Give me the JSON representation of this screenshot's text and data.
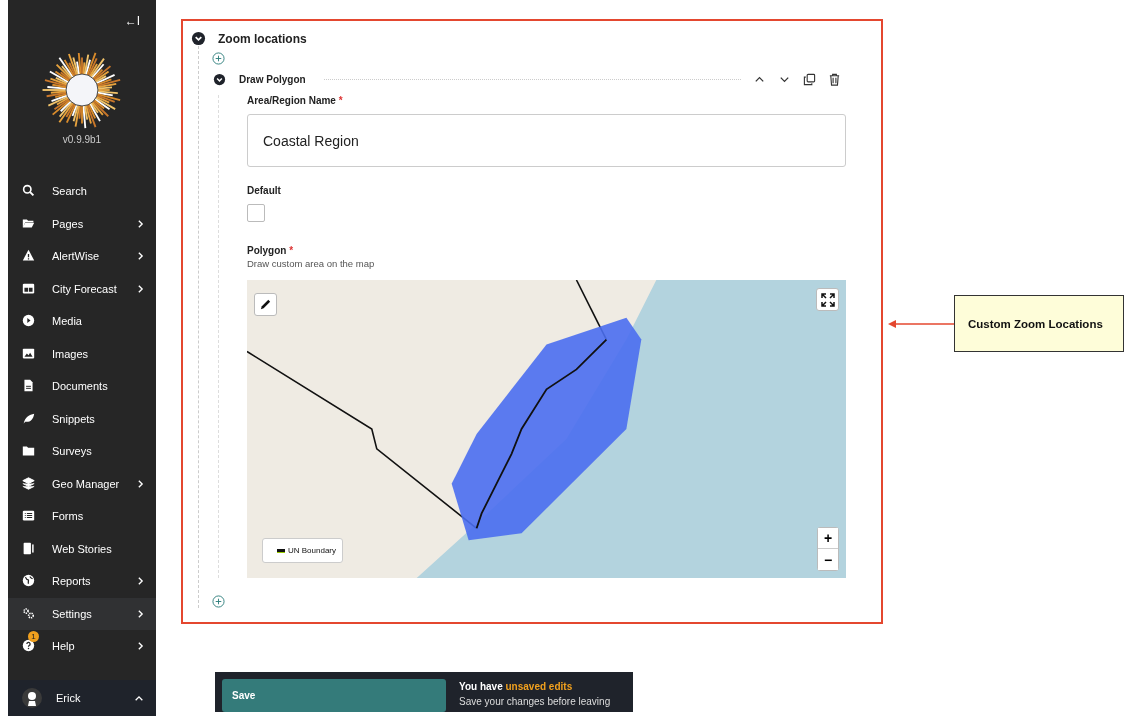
{
  "sidebar": {
    "collapse_icon": "←I",
    "version": "v0.9.9b1",
    "items": [
      {
        "label": "Search",
        "kind": "search",
        "has_submenu": false,
        "selected": false
      },
      {
        "label": "Pages",
        "kind": "folder",
        "has_submenu": true,
        "selected": false
      },
      {
        "label": "AlertWise",
        "kind": "warning",
        "has_submenu": true,
        "selected": false
      },
      {
        "label": "City Forecast",
        "kind": "table",
        "has_submenu": true,
        "selected": false
      },
      {
        "label": "Media",
        "kind": "play",
        "has_submenu": false,
        "selected": false
      },
      {
        "label": "Images",
        "kind": "image",
        "has_submenu": false,
        "selected": false
      },
      {
        "label": "Documents",
        "kind": "document",
        "has_submenu": false,
        "selected": false
      },
      {
        "label": "Snippets",
        "kind": "leaf",
        "has_submenu": false,
        "selected": false
      },
      {
        "label": "Surveys",
        "kind": "folderclosed",
        "has_submenu": false,
        "selected": false
      },
      {
        "label": "Geo Manager",
        "kind": "layers",
        "has_submenu": true,
        "selected": false
      },
      {
        "label": "Forms",
        "kind": "list",
        "has_submenu": false,
        "selected": false
      },
      {
        "label": "Web Stories",
        "kind": "stories",
        "has_submenu": false,
        "selected": false
      },
      {
        "label": "Reports",
        "kind": "globe",
        "has_submenu": true,
        "selected": false
      },
      {
        "label": "Settings",
        "kind": "cogs",
        "has_submenu": true,
        "selected": true
      },
      {
        "label": "Help",
        "kind": "help",
        "has_submenu": true,
        "selected": false,
        "badge": "1"
      }
    ],
    "user": {
      "name": "Erick"
    }
  },
  "panel": {
    "title": "Zoom locations",
    "expanded": true,
    "block": {
      "title": "Draw Polygon",
      "expanded": true,
      "name_field": {
        "label": "Area/Region Name",
        "required_mark": "*",
        "value": "Coastal Region"
      },
      "default_field": {
        "label": "Default",
        "checked": false
      },
      "polygon_field": {
        "label": "Polygon",
        "required_mark": "*",
        "help": "Draw custom area on the map",
        "legend": "UN Boundary",
        "zoom_in": "+",
        "zoom_out": "−"
      }
    }
  },
  "annotation": {
    "label": "Custom Zoom Locations"
  },
  "save_bar": {
    "button": "Save",
    "message": "You have **unsaved edits**",
    "note": "Save your changes before leaving"
  }
}
